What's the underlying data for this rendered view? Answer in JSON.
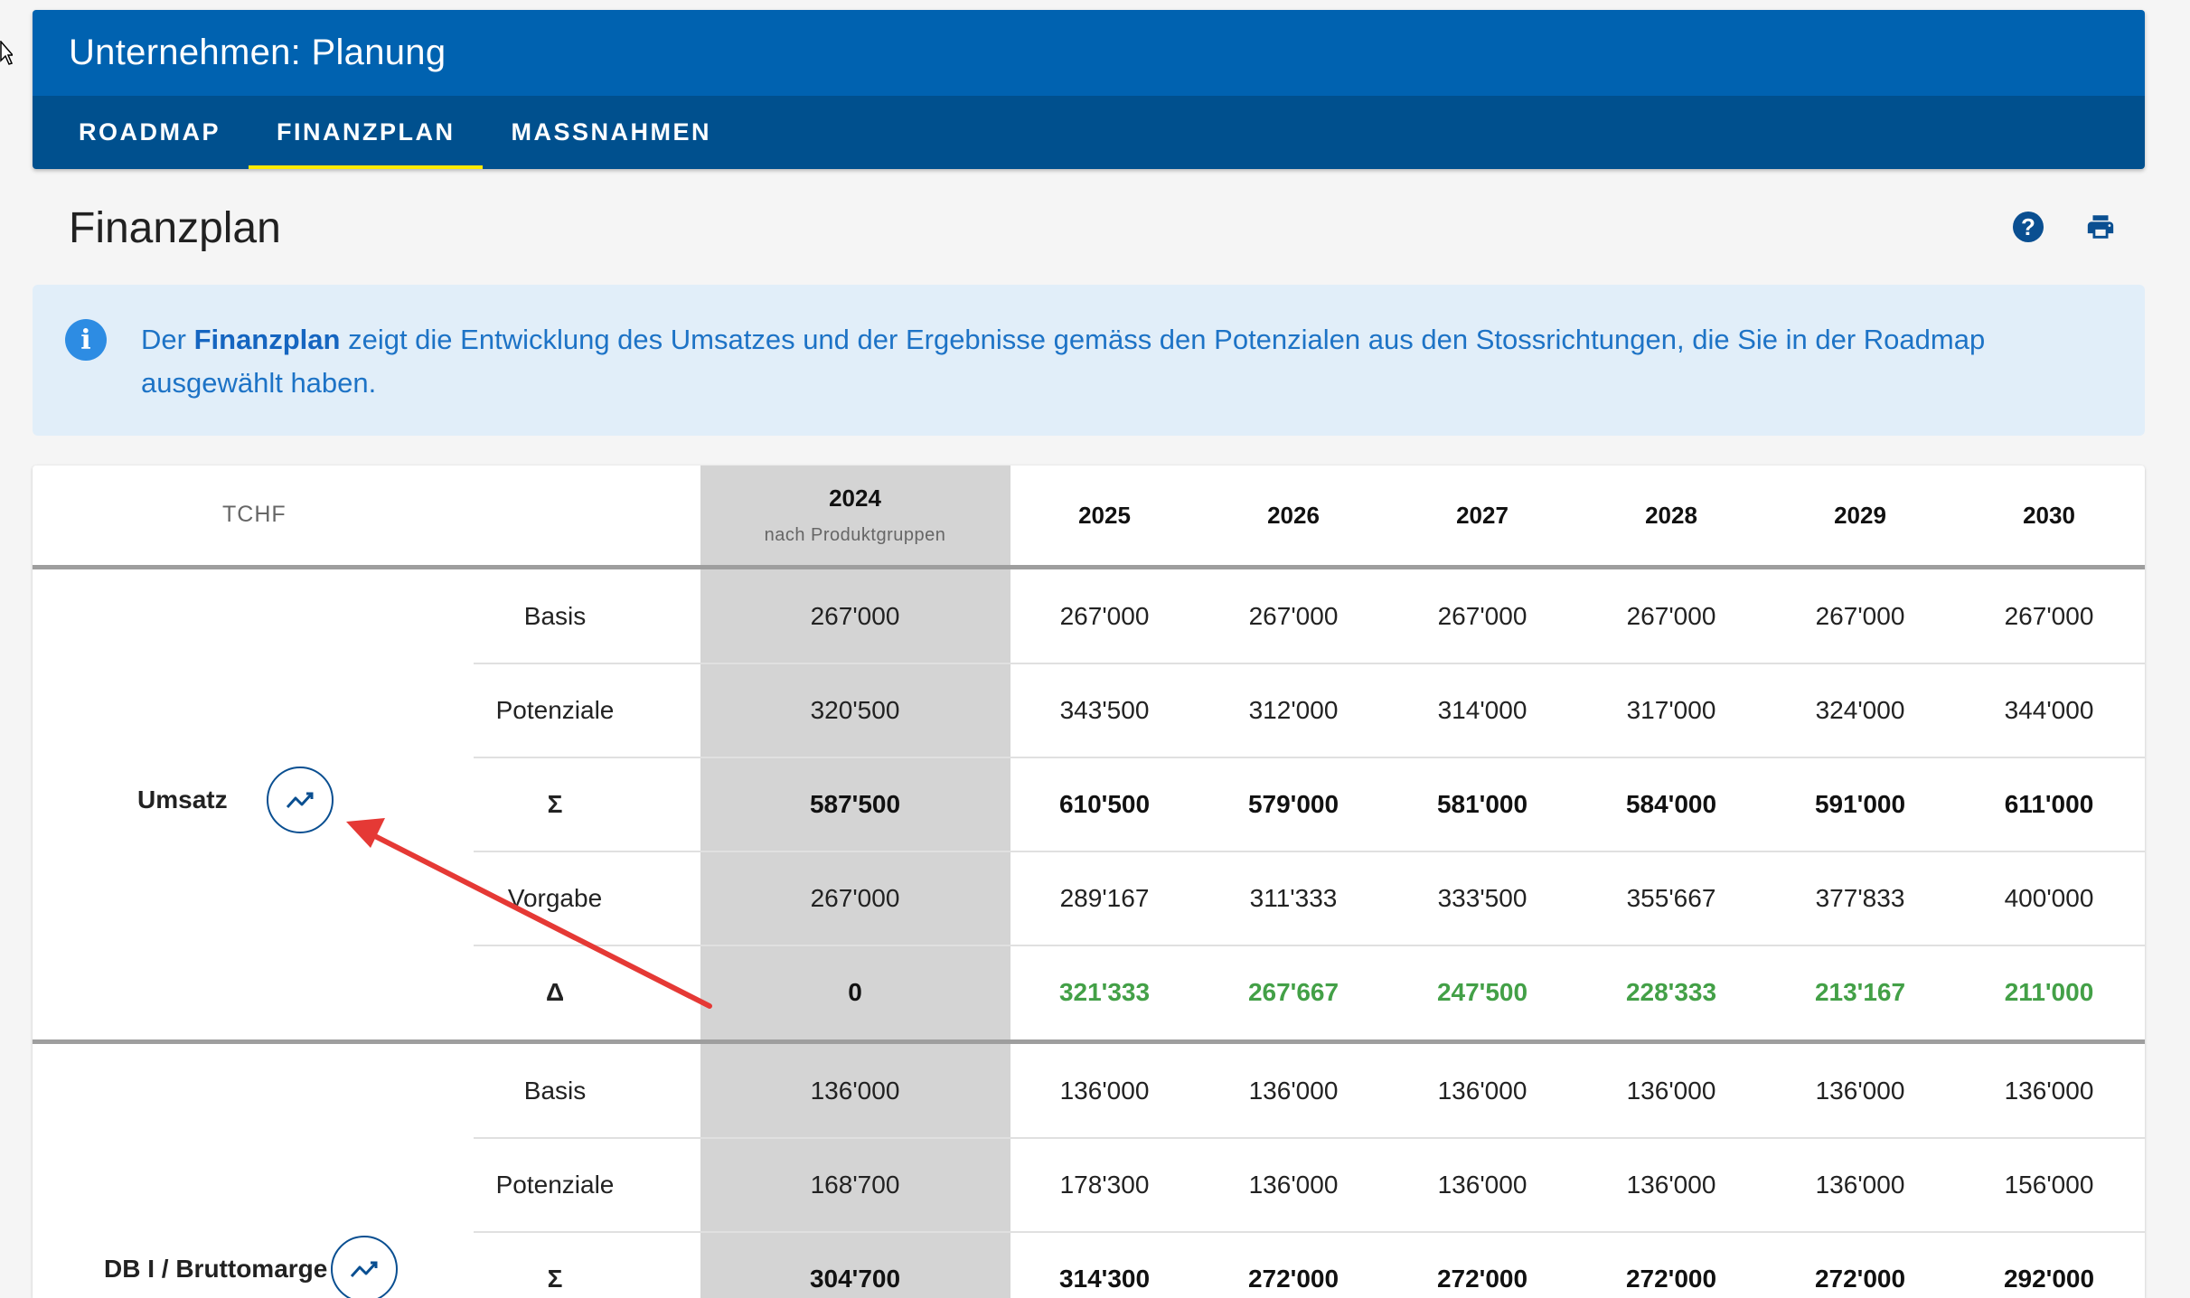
{
  "app": {
    "title": "Unternehmen: Planung",
    "tabs": [
      {
        "label": "ROADMAP"
      },
      {
        "label": "FINANZPLAN"
      },
      {
        "label": "MASSNAHMEN"
      }
    ]
  },
  "page": {
    "title": "Finanzplan"
  },
  "info": {
    "prefix": "Der ",
    "highlight": "Finanzplan",
    "text": " zeigt die Entwicklung des Umsatzes und der Ergebnisse gemäss den Potenzialen aus den Stossrichtungen, die Sie in der Roadmap ausgewählt haben."
  },
  "table": {
    "unit_label": "TCHF",
    "first_year": "2024",
    "first_year_sub": "nach Produktgruppen",
    "years": [
      "2025",
      "2026",
      "2027",
      "2028",
      "2029",
      "2030"
    ],
    "groups": [
      {
        "label": "Umsatz",
        "rows": [
          {
            "label": "Basis",
            "style": "normal",
            "values": [
              "267'000",
              "267'000",
              "267'000",
              "267'000",
              "267'000",
              "267'000",
              "267'000"
            ]
          },
          {
            "label": "Potenziale",
            "style": "normal",
            "values": [
              "320'500",
              "343'500",
              "312'000",
              "314'000",
              "317'000",
              "324'000",
              "344'000"
            ]
          },
          {
            "label": "Σ",
            "style": "bold",
            "values": [
              "587'500",
              "610'500",
              "579'000",
              "581'000",
              "584'000",
              "591'000",
              "611'000"
            ]
          },
          {
            "label": "Vorgabe",
            "style": "normal",
            "values": [
              "267'000",
              "289'167",
              "311'333",
              "333'500",
              "355'667",
              "377'833",
              "400'000"
            ]
          },
          {
            "label": "Δ",
            "style": "delta",
            "values": [
              "0",
              "321'333",
              "267'667",
              "247'500",
              "228'333",
              "213'167",
              "211'000"
            ]
          }
        ]
      },
      {
        "label": "DB I / Bruttomarge",
        "rows": [
          {
            "label": "Basis",
            "style": "normal",
            "values": [
              "136'000",
              "136'000",
              "136'000",
              "136'000",
              "136'000",
              "136'000",
              "136'000"
            ]
          },
          {
            "label": "Potenziale",
            "style": "normal",
            "values": [
              "168'700",
              "178'300",
              "136'000",
              "136'000",
              "136'000",
              "136'000",
              "156'000"
            ]
          },
          {
            "label": "Σ",
            "style": "bold",
            "values": [
              "304'700",
              "314'300",
              "272'000",
              "272'000",
              "272'000",
              "272'000",
              "292'000"
            ]
          }
        ]
      }
    ]
  },
  "icons": {
    "help": "help-circle-icon",
    "print": "printer-icon",
    "info": "info-icon",
    "chart": "trend-chart-icon",
    "cursor": "mouse-cursor-icon"
  },
  "colors": {
    "appbar": "#0062b0",
    "tabbar": "#00508e",
    "tab_indicator": "#ffea00",
    "info_bg": "#e1eef9",
    "info_text": "#1d73c6",
    "positive_delta": "#43a047",
    "annotation_arrow": "#e53935"
  }
}
